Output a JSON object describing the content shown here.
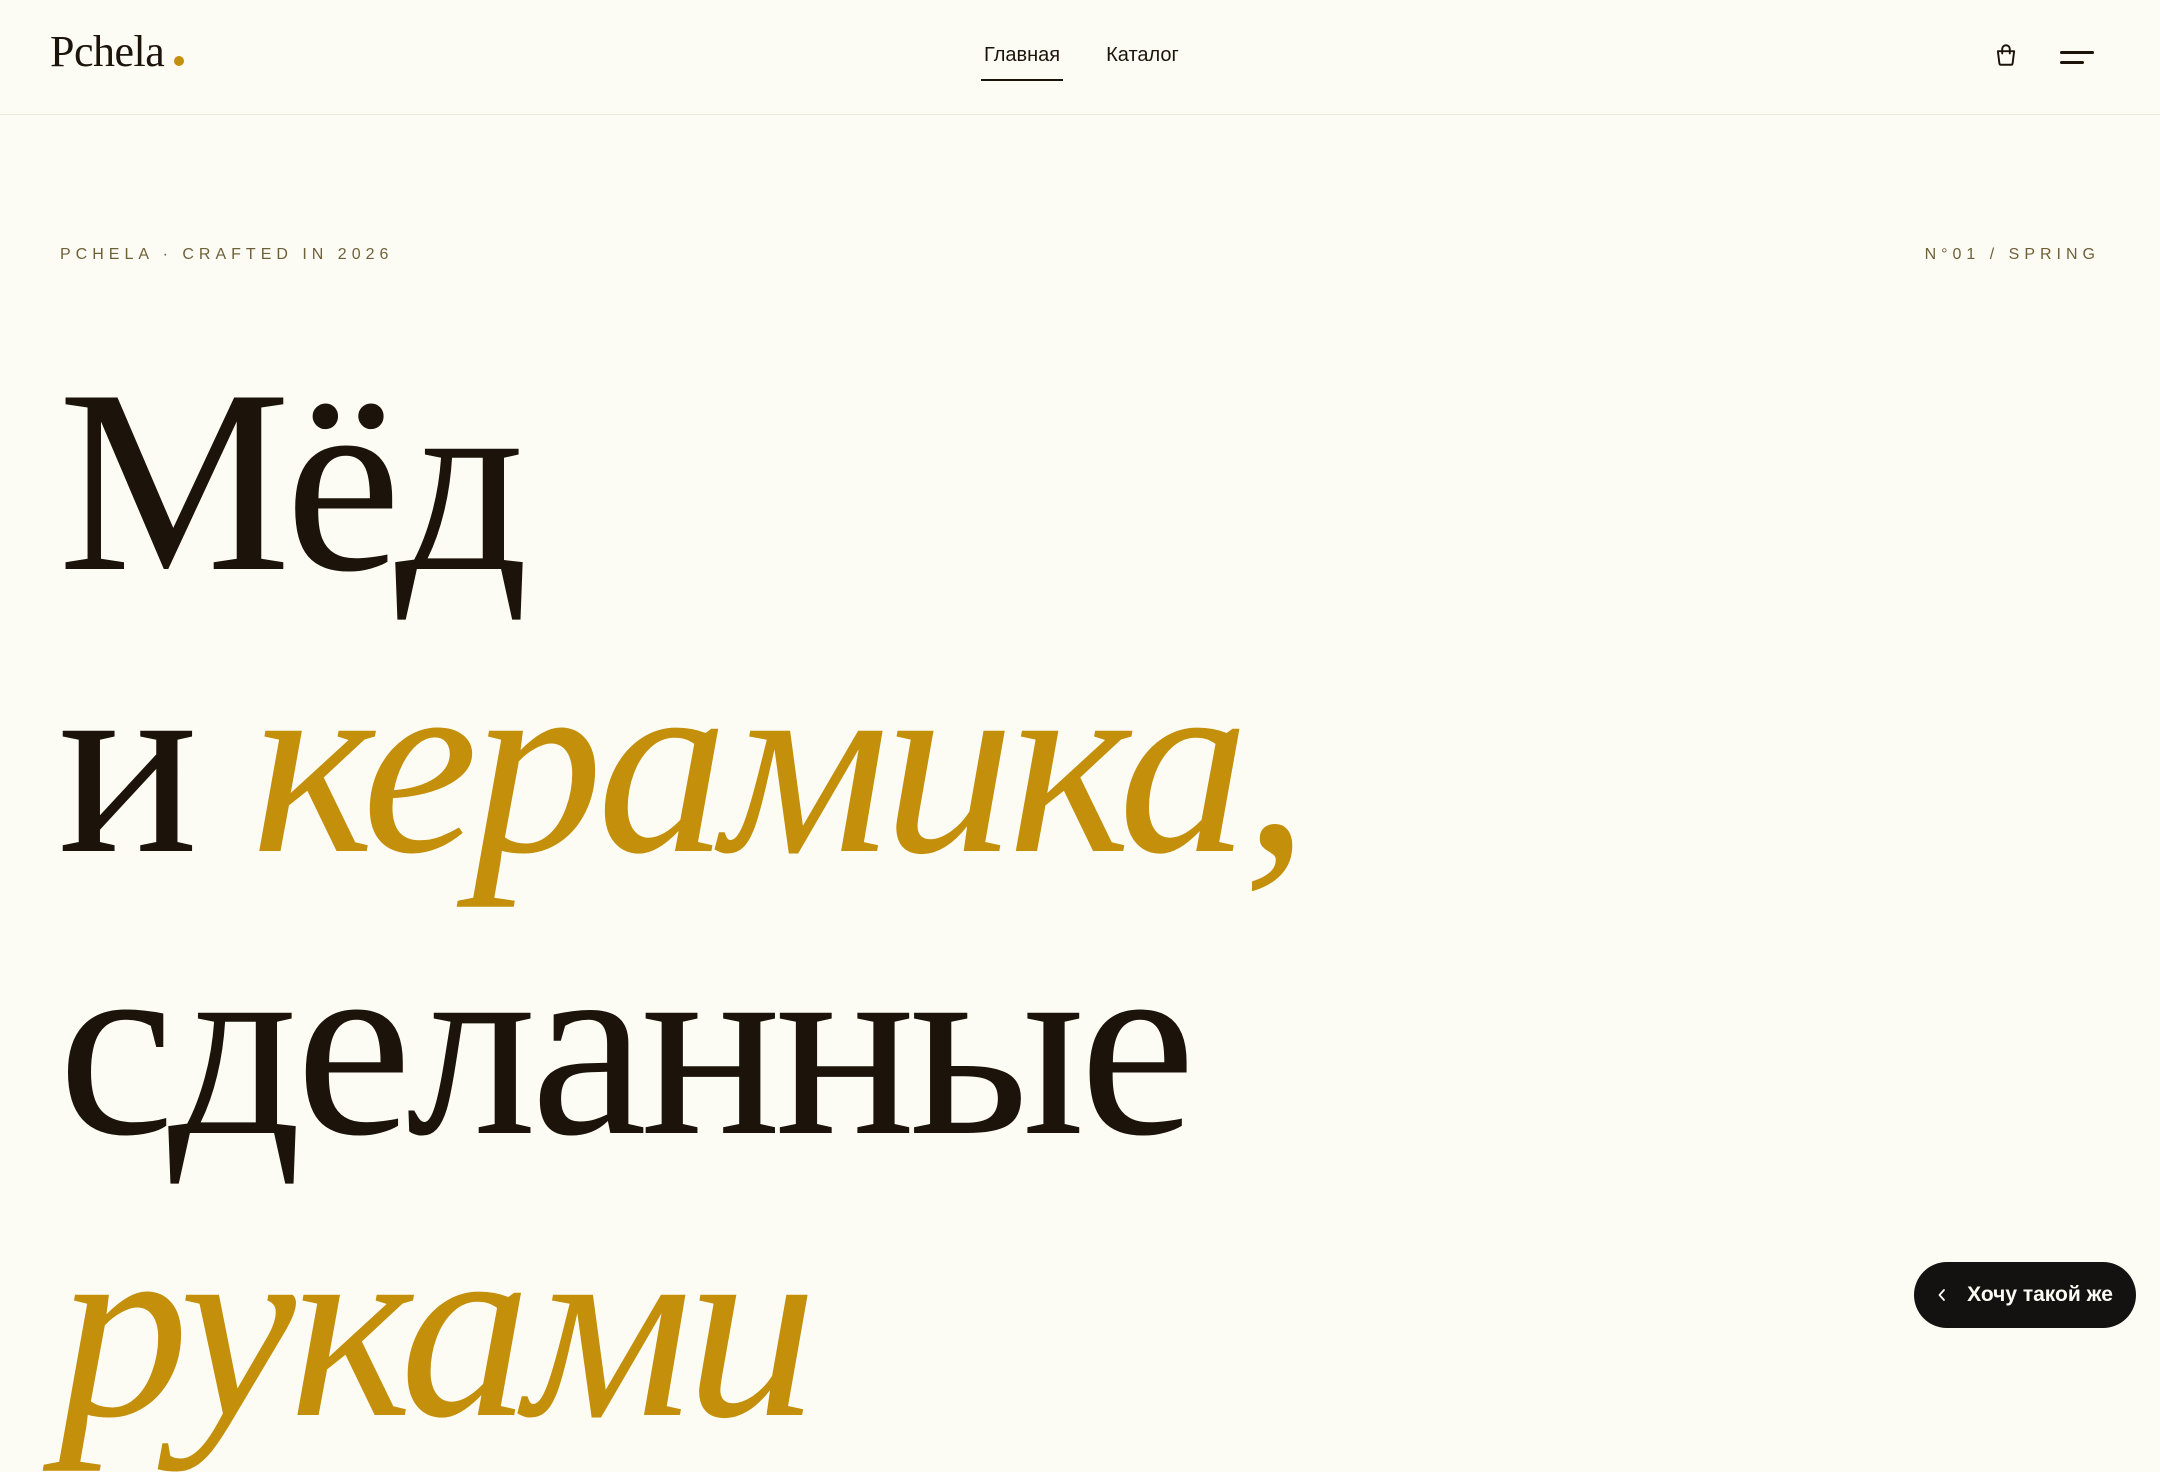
{
  "header": {
    "logo": "Pchela",
    "nav": [
      {
        "label": "Главная",
        "active": true
      },
      {
        "label": "Каталог",
        "active": false
      }
    ],
    "cart_icon": "shopping-bag-icon",
    "menu_icon": "menu-icon"
  },
  "eyebrow": {
    "left": "PCHELA · CRAFTED IN 2026",
    "right": "N°01 / SPRING"
  },
  "hero": {
    "line1": "Мёд",
    "line2_word": "и",
    "line2_accent": "керамика,",
    "line3": "сделанные",
    "line4_accent": "руками"
  },
  "cta": {
    "label": "Хочу такой же",
    "icon": "chevron-left-icon"
  },
  "colors": {
    "background": "#fdfcf4",
    "text": "#1c140a",
    "accent": "#c48f0a",
    "cta_bg": "#141210"
  }
}
